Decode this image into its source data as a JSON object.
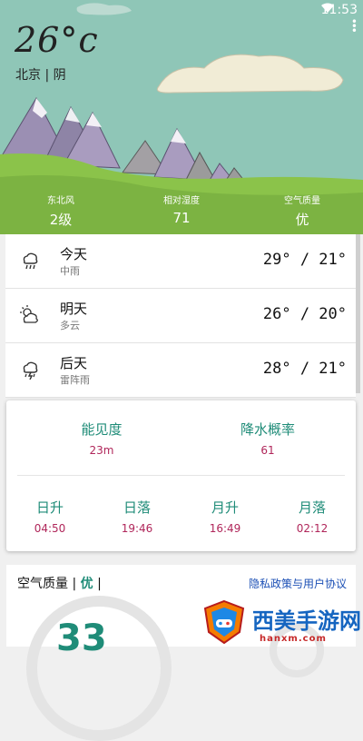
{
  "status": {
    "time": "11:53"
  },
  "current": {
    "temperature": "26°c",
    "location": "北京 | 阴"
  },
  "stats": [
    {
      "label": "东北风",
      "value": "2级"
    },
    {
      "label": "相对湿度",
      "value": "71"
    },
    {
      "label": "空气质量",
      "value": "优"
    }
  ],
  "forecast": [
    {
      "day": "今天",
      "condition": "中雨",
      "temps": "29° / 21°",
      "icon": "rain-icon"
    },
    {
      "day": "明天",
      "condition": "多云",
      "temps": "26° / 20°",
      "icon": "cloudy-icon"
    },
    {
      "day": "后天",
      "condition": "雷阵雨",
      "temps": "28° / 21°",
      "icon": "thunderstorm-icon"
    }
  ],
  "details": {
    "visibility_label": "能见度",
    "visibility_value": "23m",
    "precip_label": "降水概率",
    "precip_value": "61",
    "sunrise_label": "日升",
    "sunrise_value": "04:50",
    "sunset_label": "日落",
    "sunset_value": "19:46",
    "moonrise_label": "月升",
    "moonrise_value": "16:49",
    "moonset_label": "月落",
    "moonset_value": "02:12"
  },
  "air": {
    "title": "空气质量",
    "level": "优",
    "policy_link": "隐私政策与用户协议",
    "aqi": "33"
  },
  "watermark": {
    "text": "西美手游网",
    "url": "hanxm.com"
  },
  "colors": {
    "accent": "#1f8c78",
    "secondary": "#b0265a",
    "link": "#1b4fb5"
  }
}
